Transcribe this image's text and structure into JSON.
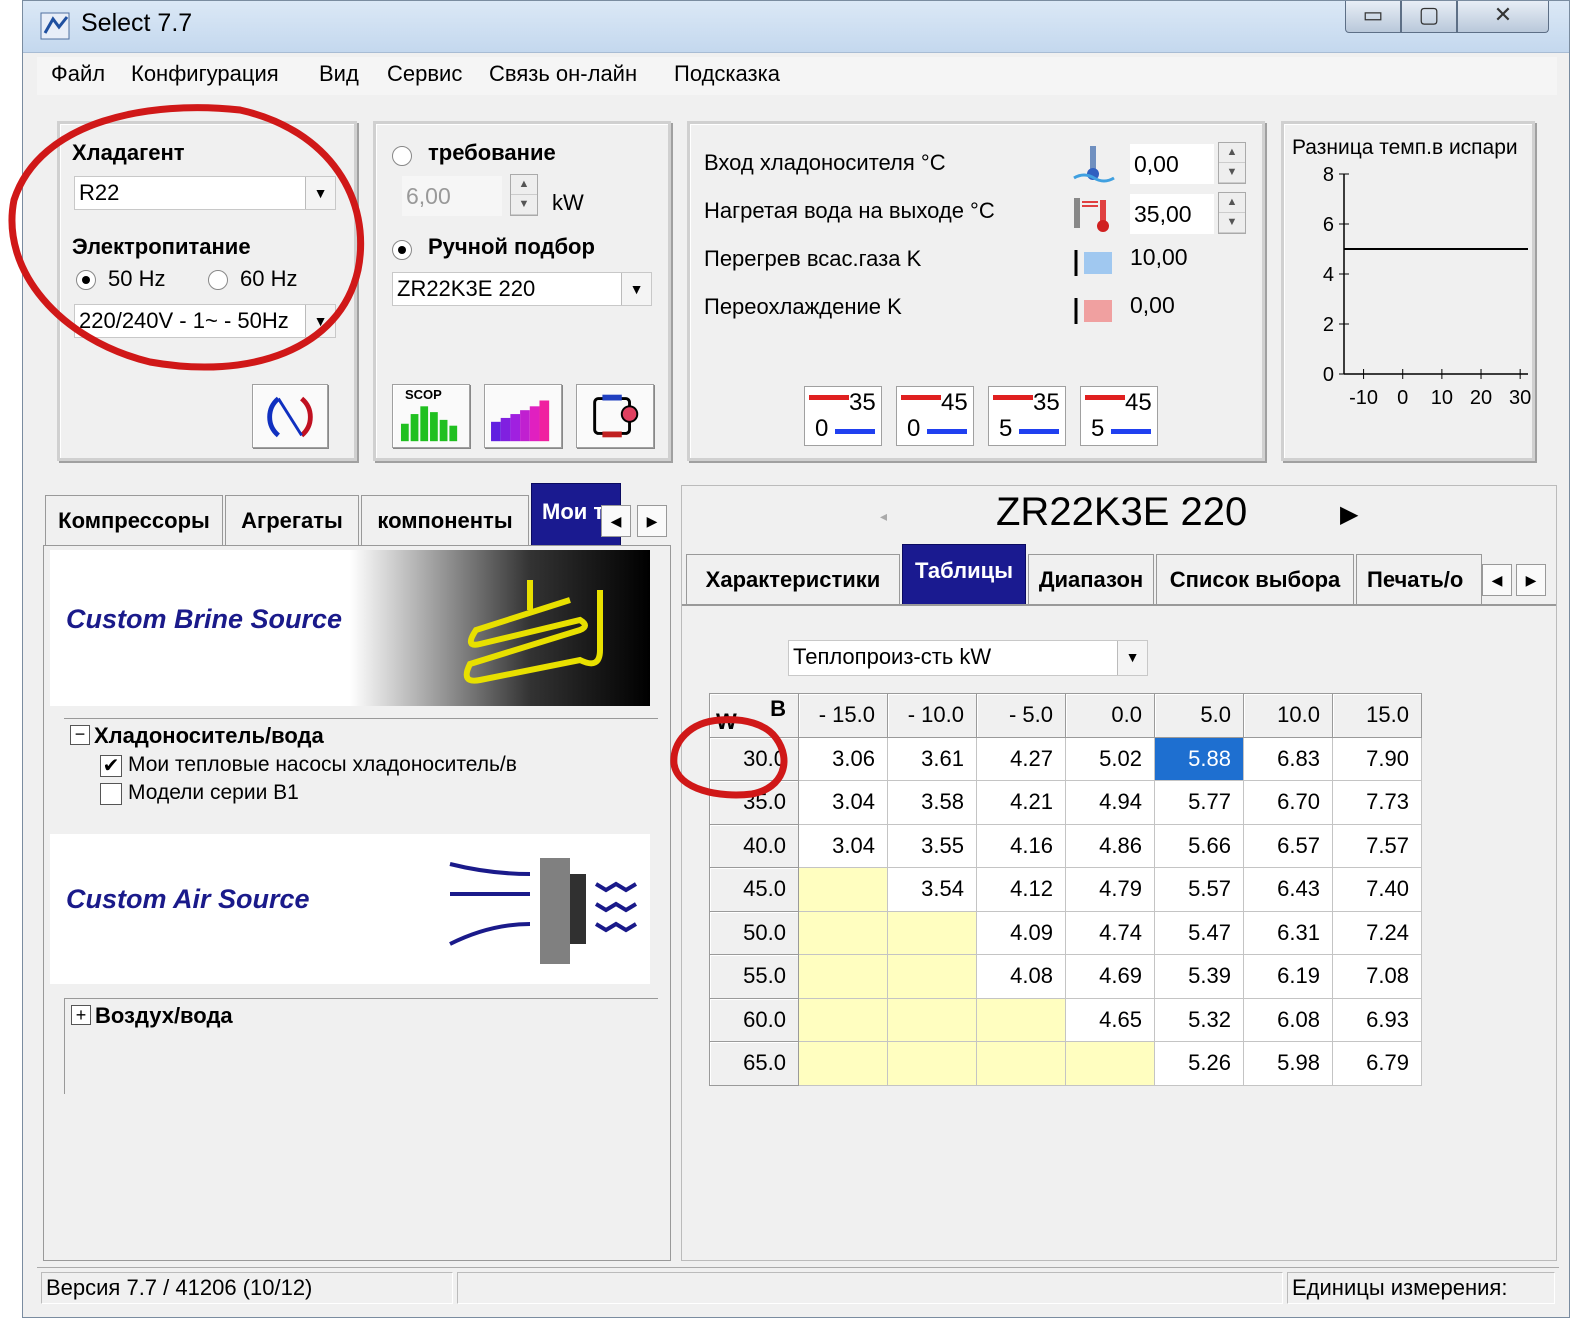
{
  "window": {
    "title": "Select 7.7",
    "min": "▭",
    "max": "▢",
    "close": "✕"
  },
  "menu": [
    "Файл",
    "Конфигурация",
    "Вид",
    "Сервис",
    "Связь он-лайн",
    "Подсказка"
  ],
  "refrigerant": {
    "label": "Хладагент",
    "value": "R22"
  },
  "power": {
    "label": "Электропитание",
    "opt50": "50 Hz",
    "opt60": "60 Hz",
    "selected": "50 Hz",
    "voltage": "220/240V - 1~ - 50Hz"
  },
  "requirement": {
    "label": "требование",
    "value": "6,00",
    "unit": "kW"
  },
  "manual": {
    "label": "Ручной подбор",
    "model": "ZR22K3E 220"
  },
  "scop_label": "SCOP",
  "conditions": [
    {
      "label": "Вход хладоносителя °C",
      "value": "0,00"
    },
    {
      "label": "Нагретая вода на выходе °C",
      "value": "35,00"
    },
    {
      "label": "Перегрев всас.газа K",
      "value": "10,00"
    },
    {
      "label": "Переохлаждение K",
      "value": "0,00"
    }
  ],
  "presets": [
    {
      "top": "35",
      "bottom": "0"
    },
    {
      "top": "45",
      "bottom": "0"
    },
    {
      "top": "35",
      "bottom": "5"
    },
    {
      "top": "45",
      "bottom": "5"
    }
  ],
  "chart": {
    "title": "Разница темп.в испари",
    "yticks": [
      "8",
      "6",
      "4",
      "2",
      "0"
    ],
    "xticks": [
      "-10",
      "0",
      "10",
      "20",
      "30"
    ]
  },
  "chart_data": {
    "type": "line",
    "title": "Разница темп.в испари",
    "ylim": [
      0,
      8
    ],
    "xlim": [
      -15,
      32
    ],
    "series": [
      {
        "x": [
          -15,
          32
        ],
        "y": [
          5,
          5
        ]
      }
    ]
  },
  "left_tabs": [
    "Компрессоры",
    "Агрегаты",
    "компоненты",
    "Мои т"
  ],
  "brine_banner": "Custom Brine Source",
  "tree1": {
    "header": "Хладоноситель/вода",
    "items": [
      {
        "label": "Мои тепловые насосы хладоноситель/в",
        "checked": true
      },
      {
        "label": "Модели серии B1",
        "checked": false
      }
    ]
  },
  "air_banner": "Custom Air Source",
  "tree2": {
    "header": "Воздух/вода"
  },
  "model_title": "ZR22K3E 220",
  "right_tabs": [
    "Характеристики",
    "Таблицы",
    "Диапазон",
    "Список выбора",
    "Печать/о"
  ],
  "table_select": "Теплопроиз-сть kW",
  "table": {
    "corner_top": "B",
    "corner_bottom": "W",
    "cols": [
      "- 15.0",
      "- 10.0",
      "- 5.0",
      "0.0",
      "5.0",
      "10.0",
      "15.0"
    ],
    "rows": [
      {
        "h": "30.0",
        "v": [
          "3.06",
          "3.61",
          "4.27",
          "5.02",
          "5.88",
          "6.83",
          "7.90"
        ]
      },
      {
        "h": "35.0",
        "v": [
          "3.04",
          "3.58",
          "4.21",
          "4.94",
          "5.77",
          "6.70",
          "7.73"
        ]
      },
      {
        "h": "40.0",
        "v": [
          "3.04",
          "3.55",
          "4.16",
          "4.86",
          "5.66",
          "6.57",
          "7.57"
        ]
      },
      {
        "h": "45.0",
        "v": [
          "",
          "3.54",
          "4.12",
          "4.79",
          "5.57",
          "6.43",
          "7.40"
        ]
      },
      {
        "h": "50.0",
        "v": [
          "",
          "",
          "4.09",
          "4.74",
          "5.47",
          "6.31",
          "7.24"
        ]
      },
      {
        "h": "55.0",
        "v": [
          "",
          "",
          "4.08",
          "4.69",
          "5.39",
          "6.19",
          "7.08"
        ]
      },
      {
        "h": "60.0",
        "v": [
          "",
          "",
          "",
          "4.65",
          "5.32",
          "6.08",
          "6.93"
        ]
      },
      {
        "h": "65.0",
        "v": [
          "",
          "",
          "",
          "",
          "5.26",
          "5.98",
          "6.79"
        ]
      }
    ]
  },
  "status": {
    "version": "Версия 7.7  / 41206 (10/12)",
    "units": "Единицы измерения:"
  },
  "colors": {
    "tab_active": "#1a1a90",
    "selected_cell": "#1e6fd0",
    "empty_cell": "#fffec0",
    "annotation": "#d01818",
    "banner_text": "#1a1a8a"
  }
}
